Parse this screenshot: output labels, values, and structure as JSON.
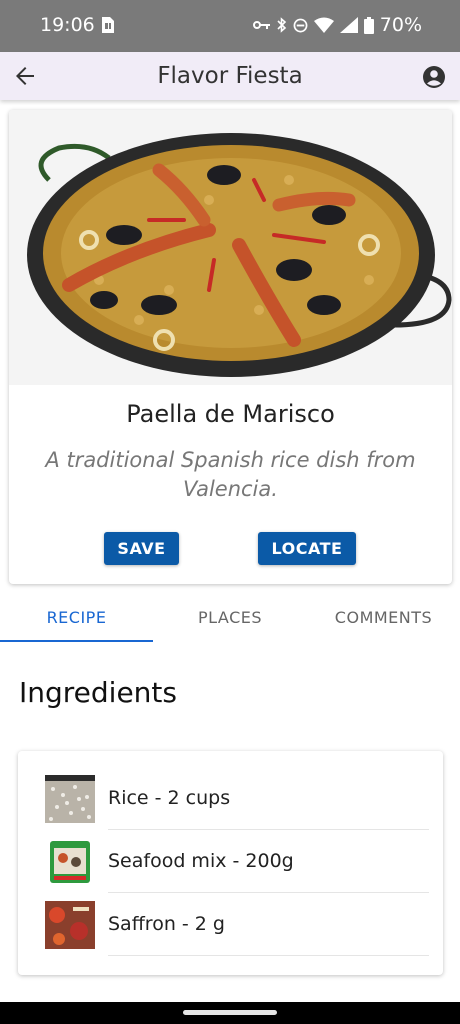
{
  "status_bar": {
    "time": "19:06",
    "battery": "70%"
  },
  "app_bar": {
    "title": "Flavor Fiesta"
  },
  "dish": {
    "name": "Paella de Marisco",
    "description": "A traditional Spanish rice dish from Valencia.",
    "save_label": "SAVE",
    "locate_label": "LOCATE"
  },
  "tabs": [
    {
      "label": "RECIPE",
      "active": true
    },
    {
      "label": "PLACES",
      "active": false
    },
    {
      "label": "COMMENTS",
      "active": false
    }
  ],
  "section": {
    "title": "Ingredients"
  },
  "ingredients": [
    {
      "label": "Rice - 2 cups",
      "icon": "rice-thumbnail"
    },
    {
      "label": "Seafood mix - 200g",
      "icon": "seafood-mix-thumbnail"
    },
    {
      "label": "Saffron - 2 g",
      "icon": "saffron-thumbnail"
    }
  ],
  "colors": {
    "accent": "#0b5aa7",
    "tab_active": "#1967d2",
    "app_bar_bg": "#f1ecf7",
    "status_bar_bg": "#7a7a7a"
  }
}
